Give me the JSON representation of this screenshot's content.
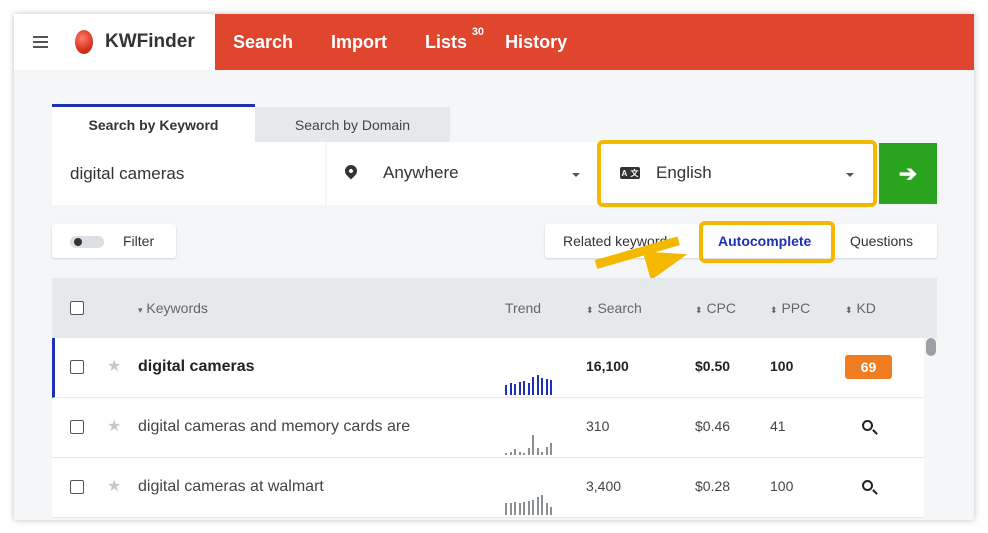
{
  "header": {
    "brand": "KWFinder",
    "nav": [
      {
        "label": "Search"
      },
      {
        "label": "Import"
      },
      {
        "label": "Lists",
        "badge": "30"
      },
      {
        "label": "History"
      }
    ],
    "accent_color": "#e0452e"
  },
  "search_tabs": {
    "active": "Search by Keyword",
    "inactive": "Search by Domain"
  },
  "search": {
    "keyword": "digital cameras",
    "location": "Anywhere",
    "language": "English"
  },
  "filter": {
    "label": "Filter",
    "enabled": false
  },
  "segments": {
    "items": [
      "Related keywords",
      "Autocomplete",
      "Questions"
    ],
    "active": "Autocomplete"
  },
  "table": {
    "columns": [
      "Keywords",
      "Trend",
      "Search",
      "CPC",
      "PPC",
      "KD"
    ],
    "rows": [
      {
        "keyword": "digital cameras",
        "search": "16,100",
        "cpc": "$0.50",
        "ppc": "100",
        "kd": "69",
        "kd_color": "#f07d22",
        "selected": true,
        "trend": [
          10,
          12,
          11,
          13,
          14,
          12,
          18,
          20,
          17,
          16,
          15
        ]
      },
      {
        "keyword": "digital cameras and memory cards are",
        "search": "310",
        "cpc": "$0.46",
        "ppc": "41",
        "kd": null,
        "selected": false,
        "trend": [
          2,
          3,
          5,
          3,
          2,
          6,
          18,
          6,
          3,
          7,
          11
        ]
      },
      {
        "keyword": "digital cameras at walmart",
        "search": "3,400",
        "cpc": "$0.28",
        "ppc": "100",
        "kd": null,
        "selected": false,
        "trend": [
          12,
          12,
          13,
          12,
          13,
          14,
          15,
          18,
          20,
          12,
          8
        ]
      }
    ]
  }
}
